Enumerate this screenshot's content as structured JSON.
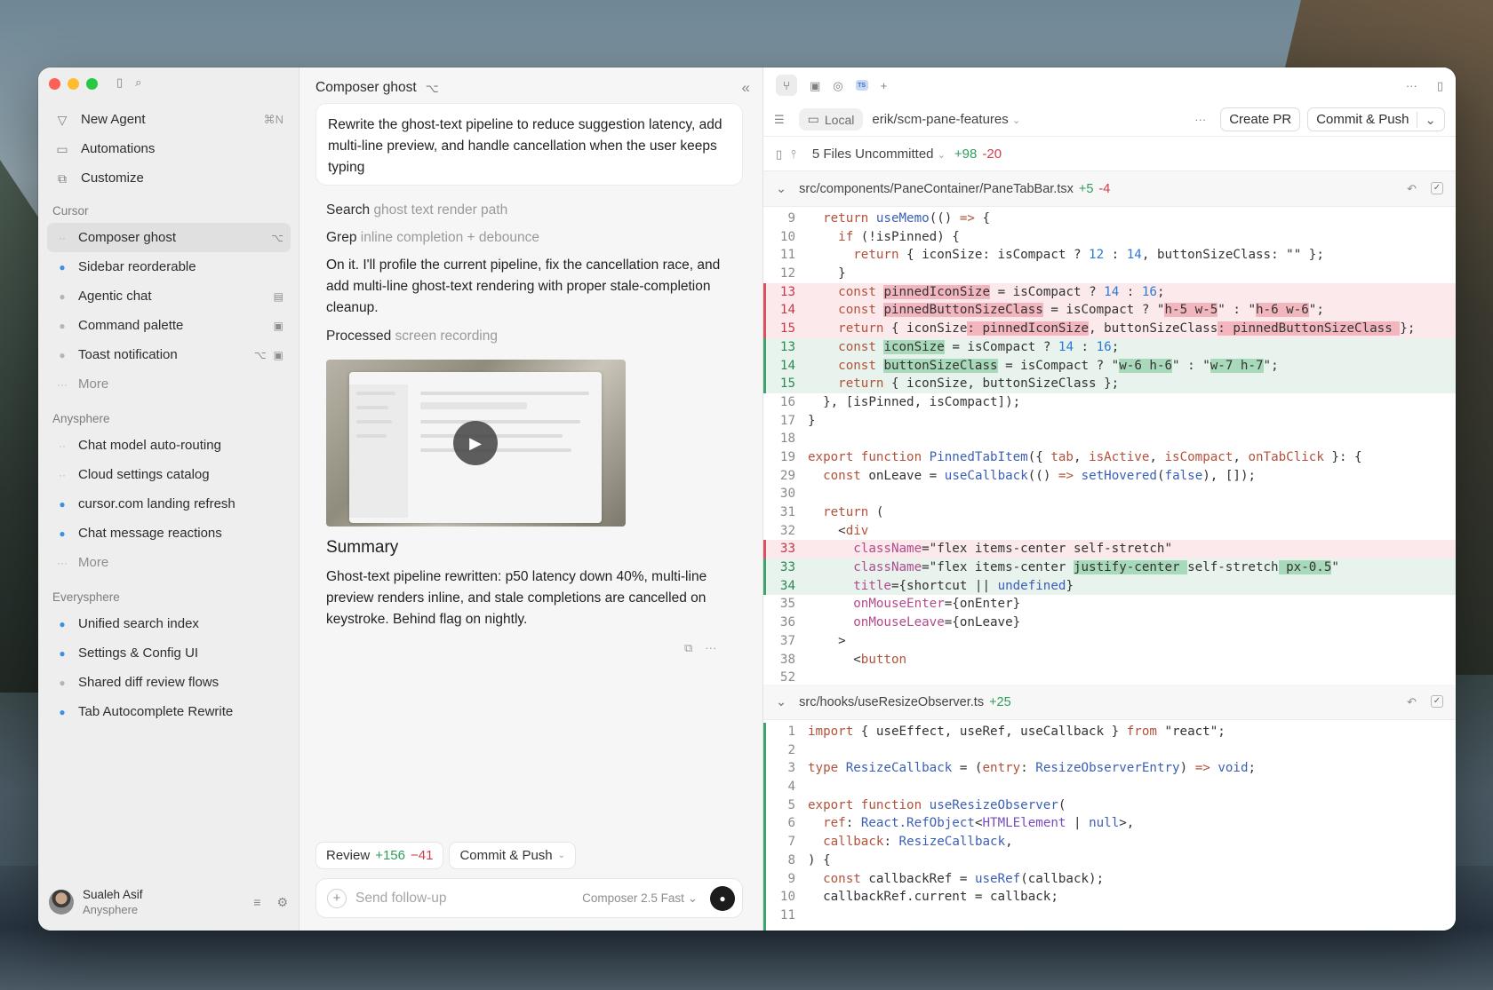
{
  "sidebar": {
    "menu": [
      {
        "label": "New Agent",
        "shortcut": "⌘N",
        "icon": "new-agent-icon"
      },
      {
        "label": "Automations",
        "icon": "automations-icon"
      },
      {
        "label": "Customize",
        "icon": "customize-icon"
      }
    ],
    "sections": [
      {
        "title": "Cursor",
        "items": [
          {
            "label": "Composer ghost",
            "active": true,
            "status": "running"
          },
          {
            "label": "Sidebar reorderable",
            "status": "unread"
          },
          {
            "label": "Agentic chat",
            "status": "idle"
          },
          {
            "label": "Command palette",
            "status": "idle"
          },
          {
            "label": "Toast notification",
            "status": "idle"
          },
          {
            "label": "More",
            "status": "more"
          }
        ]
      },
      {
        "title": "Anysphere",
        "items": [
          {
            "label": "Chat model auto-routing",
            "status": "running"
          },
          {
            "label": "Cloud settings catalog",
            "status": "running"
          },
          {
            "label": "cursor.com landing refresh",
            "status": "unread"
          },
          {
            "label": "Chat message reactions",
            "status": "unread"
          },
          {
            "label": "More",
            "status": "more"
          }
        ]
      },
      {
        "title": "Everysphere",
        "items": [
          {
            "label": "Unified search index",
            "status": "unread"
          },
          {
            "label": "Settings & Config UI",
            "status": "unread"
          },
          {
            "label": "Shared diff review flows",
            "status": "idle"
          },
          {
            "label": "Tab Autocomplete Rewrite",
            "status": "unread"
          }
        ]
      }
    ],
    "user": {
      "name": "Sualeh Asif",
      "org": "Anysphere"
    }
  },
  "chat": {
    "title": "Composer ghost",
    "prompt": "Rewrite the ghost-text pipeline to reduce suggestion latency, add multi-line preview, and handle cancellation when the user keeps typing",
    "steps": [
      {
        "verb": "Search",
        "detail": "ghost text render path"
      },
      {
        "verb": "Grep",
        "detail": "inline completion + debounce"
      }
    ],
    "reply": "On it. I'll profile the current pipeline, fix the cancellation race, and add multi-line ghost-text rendering with proper stale-completion cleanup.",
    "processed": {
      "verb": "Processed",
      "detail": "screen recording"
    },
    "summary_title": "Summary",
    "summary_text": "Ghost-text pipeline rewritten: p50 latency down 40%, multi-line preview renders inline, and stale completions are cancelled on keystroke. Behind flag on nightly.",
    "review": {
      "label": "Review",
      "added": "+156",
      "removed": "−41"
    },
    "commit_push": "Commit & Push",
    "composer_placeholder": "Send follow-up",
    "model": "Composer 2.5 Fast"
  },
  "diff": {
    "local_label": "Local",
    "branch": "erik/scm-pane-features",
    "create_pr": "Create PR",
    "commit_push": "Commit & Push",
    "uncommitted": "5 Files Uncommitted",
    "total_added": "+98",
    "total_removed": "-20",
    "files": [
      {
        "path": "src/components/PaneContainer/PaneTabBar.tsx",
        "added": "+5",
        "removed": "-4"
      },
      {
        "path": "src/hooks/useResizeObserver.ts",
        "added": "+25",
        "removed": ""
      }
    ]
  },
  "colors": {
    "added": "#2e9e5b",
    "removed": "#d23c4a",
    "accent": "#3d8fe0"
  }
}
